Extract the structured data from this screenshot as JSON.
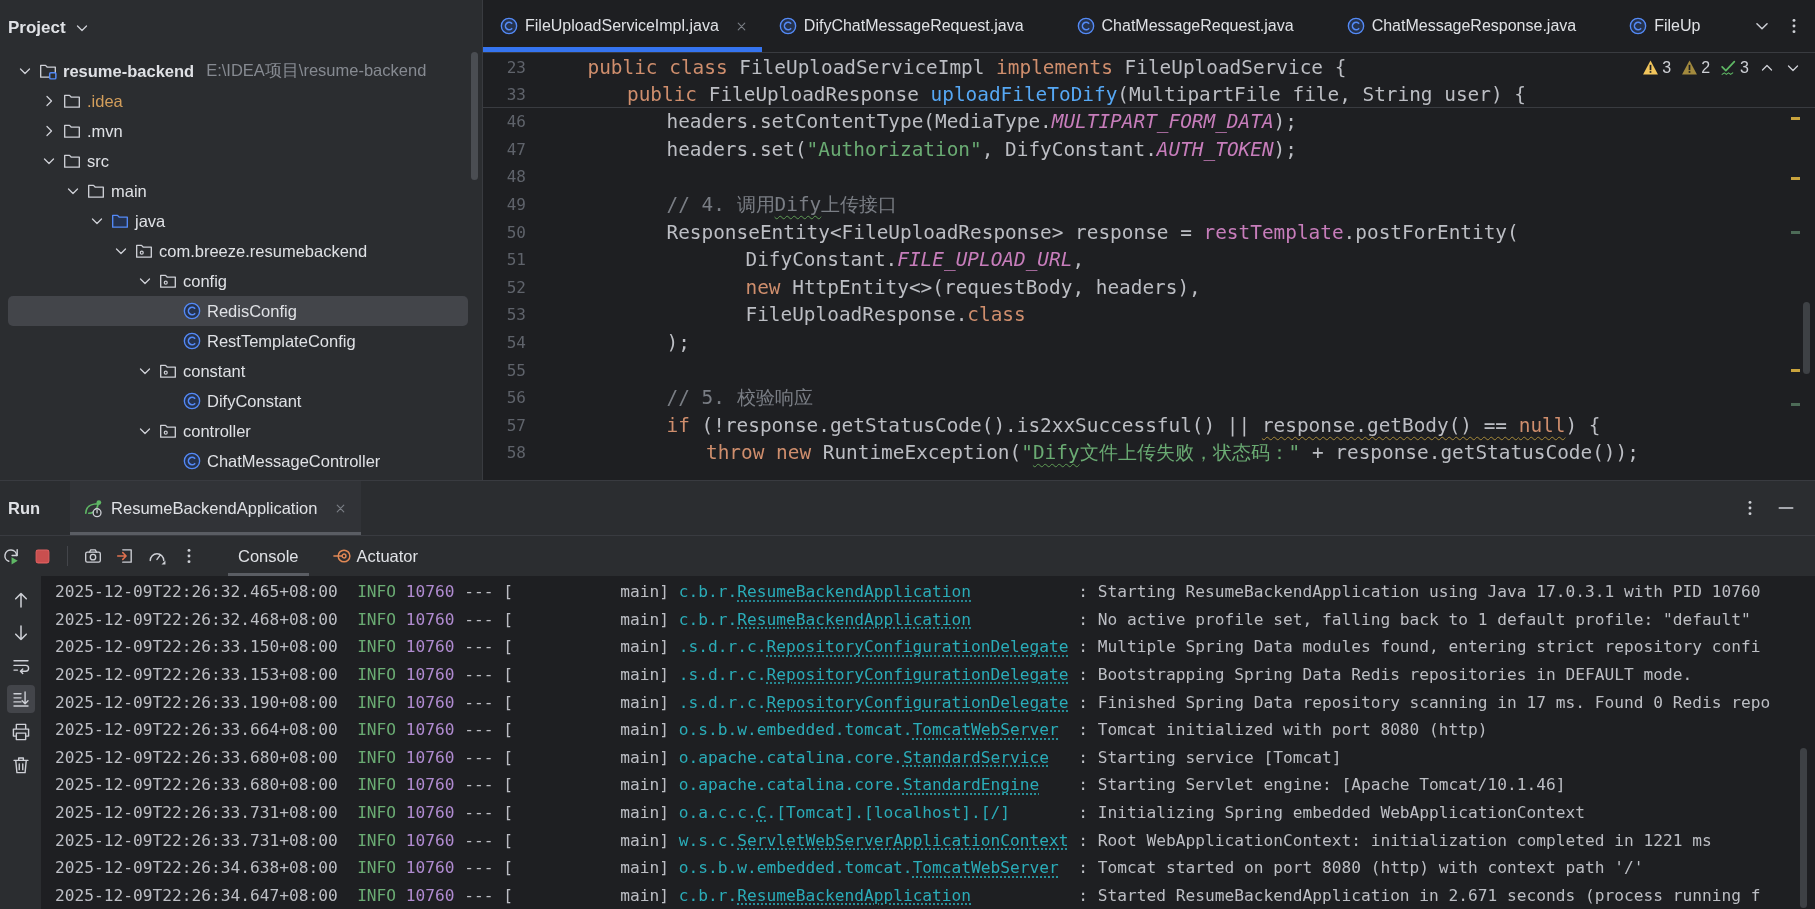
{
  "project": {
    "title": "Project",
    "tree": [
      {
        "label": "resume-backend",
        "path": "E:\\IDEA项目\\resume-backend",
        "kind": "module",
        "expanded": true,
        "ignored": false,
        "selected": false,
        "children": [
          {
            "label": ".idea",
            "kind": "folder",
            "expanded": false,
            "ignored": true,
            "selected": false
          },
          {
            "label": ".mvn",
            "kind": "folder",
            "expanded": false,
            "ignored": false,
            "selected": false
          },
          {
            "label": "src",
            "kind": "folder",
            "expanded": true,
            "ignored": false,
            "selected": false,
            "children": [
              {
                "label": "main",
                "kind": "folder",
                "expanded": true,
                "ignored": false,
                "selected": false,
                "children": [
                  {
                    "label": "java",
                    "kind": "source-folder",
                    "expanded": true,
                    "ignored": false,
                    "selected": false,
                    "children": [
                      {
                        "label": "com.breeze.resumebackend",
                        "kind": "package",
                        "expanded": true,
                        "ignored": false,
                        "selected": false,
                        "children": [
                          {
                            "label": "config",
                            "kind": "package",
                            "expanded": true,
                            "ignored": false,
                            "selected": false,
                            "children": [
                              {
                                "label": "RedisConfig",
                                "kind": "class",
                                "ignored": false,
                                "selected": true
                              },
                              {
                                "label": "RestTemplateConfig",
                                "kind": "class",
                                "ignored": false,
                                "selected": false
                              }
                            ]
                          },
                          {
                            "label": "constant",
                            "kind": "package",
                            "expanded": true,
                            "ignored": false,
                            "selected": false,
                            "children": [
                              {
                                "label": "DifyConstant",
                                "kind": "class",
                                "ignored": false,
                                "selected": false
                              }
                            ]
                          },
                          {
                            "label": "controller",
                            "kind": "package",
                            "expanded": true,
                            "ignored": false,
                            "selected": false,
                            "children": [
                              {
                                "label": "ChatMessageController",
                                "kind": "class",
                                "ignored": false,
                                "selected": false
                              }
                            ]
                          }
                        ]
                      }
                    ]
                  }
                ]
              }
            ]
          }
        ]
      }
    ]
  },
  "editor": {
    "tabs": [
      {
        "label": "FileUploadServiceImpl.java",
        "selected": true
      },
      {
        "label": "DifyChatMessageRequest.java",
        "selected": false
      },
      {
        "label": "ChatMessageRequest.java",
        "selected": false
      },
      {
        "label": "ChatMessageResponse.java",
        "selected": false
      },
      {
        "label": "FileUp",
        "selected": false
      }
    ],
    "inspections": [
      {
        "kind": "warning",
        "count": "3"
      },
      {
        "kind": "weak-warning",
        "count": "2"
      },
      {
        "kind": "typo",
        "count": "3"
      }
    ],
    "sticky_lines": [
      {
        "number": "23",
        "tokens": [
          {
            "kind": "keyword",
            "text": "\tpublic class "
          },
          {
            "kind": "plain",
            "text": "FileUploadServiceImpl "
          },
          {
            "kind": "keyword",
            "text": "implements "
          },
          {
            "kind": "plain",
            "text": "FileUploadService {"
          }
        ]
      },
      {
        "number": "33",
        "tokens": [
          {
            "kind": "keyword",
            "text": "\t\tpublic "
          },
          {
            "kind": "plain",
            "text": "FileUploadResponse "
          },
          {
            "kind": "method",
            "text": "uploadFileToDify"
          },
          {
            "kind": "plain",
            "text": "(MultipartFile file, String user) {"
          }
        ]
      }
    ],
    "lines": [
      {
        "number": "46",
        "tokens": [
          {
            "kind": "plain",
            "text": "\t\t\theaders.setContentType(MediaType."
          },
          {
            "kind": "constant",
            "text": "MULTIPART_FORM_DATA"
          },
          {
            "kind": "plain",
            "text": ");"
          }
        ]
      },
      {
        "number": "47",
        "tokens": [
          {
            "kind": "plain",
            "text": "\t\t\theaders.set("
          },
          {
            "kind": "string",
            "text": "\"Authorization\""
          },
          {
            "kind": "plain",
            "text": ", DifyConstant."
          },
          {
            "kind": "constant",
            "text": "AUTH_TOKEN"
          },
          {
            "kind": "plain",
            "text": ");"
          }
        ]
      },
      {
        "number": "48"
      },
      {
        "number": "49",
        "tokens": [
          {
            "kind": "comment",
            "text": "\t\t\t// 4. 调用"
          },
          {
            "kind": "comment-typo",
            "text": "Dify"
          },
          {
            "kind": "comment",
            "text": "上传接口"
          }
        ]
      },
      {
        "number": "50",
        "tokens": [
          {
            "kind": "plain",
            "text": "\t\t\tResponseEntity<FileUploadResponse> response = "
          },
          {
            "kind": "field",
            "text": "restTemplate"
          },
          {
            "kind": "plain",
            "text": ".postForEntity("
          }
        ]
      },
      {
        "number": "51",
        "tokens": [
          {
            "kind": "plain",
            "text": "\t\t\t\t\tDifyConstant."
          },
          {
            "kind": "constant",
            "text": "FILE_UPLOAD_URL"
          },
          {
            "kind": "plain",
            "text": ","
          }
        ]
      },
      {
        "number": "52",
        "tokens": [
          {
            "kind": "keyword",
            "text": "\t\t\t\t\tnew "
          },
          {
            "kind": "plain",
            "text": "HttpEntity<>(requestBody, headers),"
          }
        ]
      },
      {
        "number": "53",
        "tokens": [
          {
            "kind": "plain",
            "text": "\t\t\t\t\tFileUploadResponse."
          },
          {
            "kind": "keyword",
            "text": "class"
          }
        ]
      },
      {
        "number": "54",
        "tokens": [
          {
            "kind": "plain",
            "text": "\t\t\t);"
          }
        ]
      },
      {
        "number": "55"
      },
      {
        "number": "56",
        "tokens": [
          {
            "kind": "comment",
            "text": "\t\t\t// 5. 校验响应"
          }
        ]
      },
      {
        "number": "57",
        "tokens": [
          {
            "kind": "keyword",
            "text": "\t\t\tif "
          },
          {
            "kind": "plain",
            "text": "(!response.getStatusCode().is2xxSuccessful() || "
          },
          {
            "kind": "warning",
            "text": "response.getBody() == "
          },
          {
            "kind": "warning-keyword",
            "text": "null"
          },
          {
            "kind": "plain",
            "text": ") {"
          }
        ]
      },
      {
        "number": "58",
        "tokens": [
          {
            "kind": "keyword",
            "text": "\t\t\t\tthrow new "
          },
          {
            "kind": "plain",
            "text": "RuntimeException("
          },
          {
            "kind": "string",
            "text": "\""
          },
          {
            "kind": "string-typo",
            "text": "Dify"
          },
          {
            "kind": "string",
            "text": "文件上传失败，状态码：\""
          },
          {
            "kind": "plain",
            "text": " + response.getStatusCode());"
          }
        ]
      }
    ],
    "stripe_marks": [
      {
        "kind": "warning"
      },
      {
        "kind": "warning"
      },
      {
        "kind": "info"
      },
      {
        "kind": "warning"
      },
      {
        "kind": "info"
      }
    ]
  },
  "run": {
    "title": "Run",
    "tabs": [
      {
        "label": "ResumeBackendApplication",
        "selected": true
      }
    ],
    "view_tabs": [
      {
        "label": "Console",
        "selected": true
      },
      {
        "label": "Actuator",
        "selected": false
      }
    ],
    "side_actions": [
      {
        "kind": "up",
        "on": false
      },
      {
        "kind": "down",
        "on": false
      },
      {
        "kind": "wrap",
        "on": false
      },
      {
        "kind": "scroll-end",
        "on": true
      },
      {
        "kind": "print",
        "on": false
      },
      {
        "kind": "clear",
        "on": false
      }
    ],
    "console": [
      {
        "time": "2025-12-09T22:26:32.465+08:00",
        "level": "INFO",
        "pid": "10760",
        "separator": "---",
        "thread": "[           main]",
        "logger_package": "c.b.r.",
        "logger_class": "ResumeBackendApplication",
        "message": ": Starting ResumeBackendApplication using Java 17.0.3.1 with PID 10760"
      },
      {
        "time": "2025-12-09T22:26:32.468+08:00",
        "level": "INFO",
        "pid": "10760",
        "separator": "---",
        "thread": "[           main]",
        "logger_package": "c.b.r.",
        "logger_class": "ResumeBackendApplication",
        "message": ": No active profile set, falling back to 1 default profile: \"default\""
      },
      {
        "time": "2025-12-09T22:26:33.150+08:00",
        "level": "INFO",
        "pid": "10760",
        "separator": "---",
        "thread": "[           main]",
        "logger_package": ".s.d.r.c.",
        "logger_class": "RepositoryConfigurationDelegate",
        "message": ": Multiple Spring Data modules found, entering strict repository confi"
      },
      {
        "time": "2025-12-09T22:26:33.153+08:00",
        "level": "INFO",
        "pid": "10760",
        "separator": "---",
        "thread": "[           main]",
        "logger_package": ".s.d.r.c.",
        "logger_class": "RepositoryConfigurationDelegate",
        "message": ": Bootstrapping Spring Data Redis repositories in DEFAULT mode."
      },
      {
        "time": "2025-12-09T22:26:33.190+08:00",
        "level": "INFO",
        "pid": "10760",
        "separator": "---",
        "thread": "[           main]",
        "logger_package": ".s.d.r.c.",
        "logger_class": "RepositoryConfigurationDelegate",
        "message": ": Finished Spring Data repository scanning in 17 ms. Found 0 Redis repo"
      },
      {
        "time": "2025-12-09T22:26:33.664+08:00",
        "level": "INFO",
        "pid": "10760",
        "separator": "---",
        "thread": "[           main]",
        "logger_package": "o.s.b.w.embedded.tomcat.",
        "logger_class": "TomcatWebServer",
        "message": ": Tomcat initialized with port 8080 (http)"
      },
      {
        "time": "2025-12-09T22:26:33.680+08:00",
        "level": "INFO",
        "pid": "10760",
        "separator": "---",
        "thread": "[           main]",
        "logger_package": "o.apache.catalina.core.",
        "logger_class": "StandardService",
        "message": ": Starting service [Tomcat]"
      },
      {
        "time": "2025-12-09T22:26:33.680+08:00",
        "level": "INFO",
        "pid": "10760",
        "separator": "---",
        "thread": "[           main]",
        "logger_package": "o.apache.catalina.core.",
        "logger_class": "StandardEngine",
        "message": ": Starting Servlet engine: [Apache Tomcat/10.1.46]"
      },
      {
        "time": "2025-12-09T22:26:33.731+08:00",
        "level": "INFO",
        "pid": "10760",
        "separator": "---",
        "thread": "[           main]",
        "logger_package": "o.a.c.c.",
        "logger_class": "C",
        "logger_suffix": ".[Tomcat].[localhost].[/]",
        "message": ": Initializing Spring embedded WebApplicationContext"
      },
      {
        "time": "2025-12-09T22:26:33.731+08:00",
        "level": "INFO",
        "pid": "10760",
        "separator": "---",
        "thread": "[           main]",
        "logger_package": "w.s.c.",
        "logger_class": "ServletWebServerApplicationContext",
        "message": ": Root WebApplicationContext: initialization completed in 1221 ms"
      },
      {
        "time": "2025-12-09T22:26:34.638+08:00",
        "level": "INFO",
        "pid": "10760",
        "separator": "---",
        "thread": "[           main]",
        "logger_package": "o.s.b.w.embedded.tomcat.",
        "logger_class": "TomcatWebServer",
        "message": ": Tomcat started on port 8080 (http) with context path '/'"
      },
      {
        "time": "2025-12-09T22:26:34.647+08:00",
        "level": "INFO",
        "pid": "10760",
        "separator": "---",
        "thread": "[           main]",
        "logger_package": "c.b.r.",
        "logger_class": "ResumeBackendApplication",
        "message": ": Started ResumeBackendApplication in 2.671 seconds (process running f"
      }
    ]
  }
}
